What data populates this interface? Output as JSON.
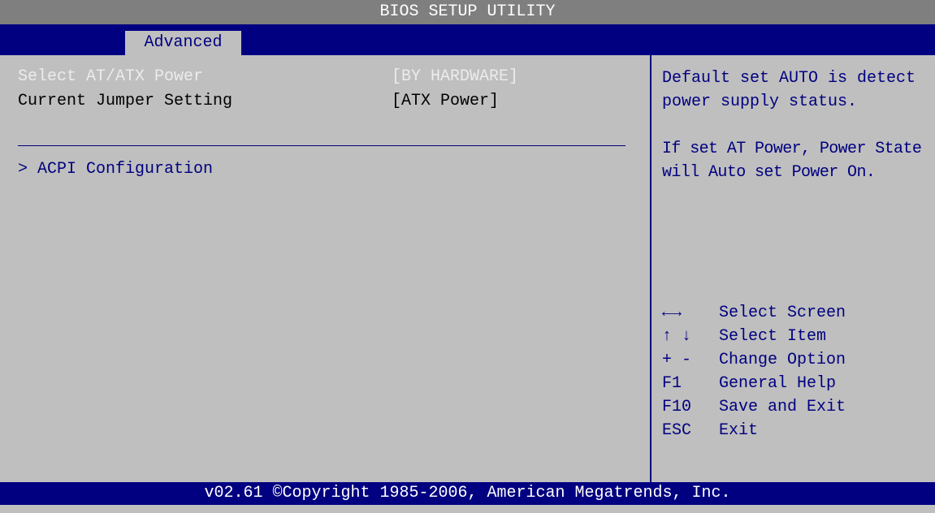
{
  "window": {
    "title": "BIOS SETUP UTILITY"
  },
  "tabs": {
    "active": "Advanced"
  },
  "settings": [
    {
      "label": "Select AT/ATX Power",
      "value": "[BY HARDWARE]"
    },
    {
      "label": "Current Jumper Setting",
      "value": "[ATX Power]"
    }
  ],
  "submenu": {
    "label": "> ACPI Configuration"
  },
  "help": {
    "para1": "Default set AUTO is detect power supply status.",
    "para2": "If set AT Power, Power State will Auto set Power On."
  },
  "keys": [
    {
      "key": "←→",
      "desc": "Select Screen"
    },
    {
      "key": "↑ ↓",
      "desc": "Select Item"
    },
    {
      "key": "+ -",
      "desc": "Change Option"
    },
    {
      "key": "F1",
      "desc": "General Help"
    },
    {
      "key": "F10",
      "desc": "Save and Exit"
    },
    {
      "key": "ESC",
      "desc": "Exit"
    }
  ],
  "footer": {
    "copyright": "v02.61 ©Copyright 1985-2006, American Megatrends, Inc."
  },
  "colors": {
    "background": "#bfbfbf",
    "accent": "#000080",
    "titlebar": "#7f7f7f",
    "disabled_text": "#ececec"
  }
}
